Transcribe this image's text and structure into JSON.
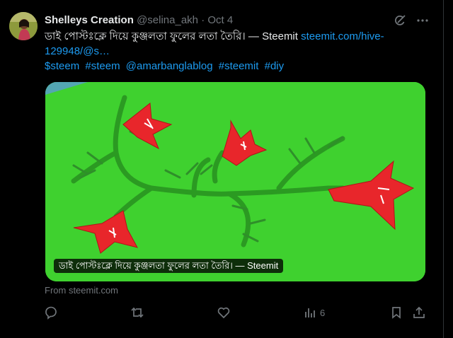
{
  "post": {
    "author_name": "Shelleys Creation",
    "author_handle": "@selina_akh",
    "separator": "·",
    "date": "Oct 4",
    "text_main": "ডাই পোস্টঃক্লে দিয়ে কুঞ্জলতা ফুলের লতা তৈরি। — Steemit ",
    "text_link": "steemit.com/hive-129948/@s…",
    "hashtags": [
      "$steem",
      "#steem",
      "@amarbanglablog",
      "#steemit",
      "#diy"
    ],
    "card_caption": "ডাই পোস্টঃক্লে দিয়ে কুঞ্জলতা ফুলের লতা তৈরি। — Steemit",
    "card_source": "From steemit.com",
    "views_count": "6"
  },
  "icons": {
    "grok": "grok-icon",
    "more": "more-icon",
    "reply": "reply-icon",
    "retweet": "retweet-icon",
    "like": "like-icon",
    "views": "views-icon",
    "bookmark": "bookmark-icon",
    "share": "share-icon"
  },
  "colors": {
    "background": "#000000",
    "text": "#e7e9ea",
    "muted": "#71767b",
    "link": "#1d9bf0",
    "card_background": "#3fd12f",
    "flower": "#e8262b"
  }
}
